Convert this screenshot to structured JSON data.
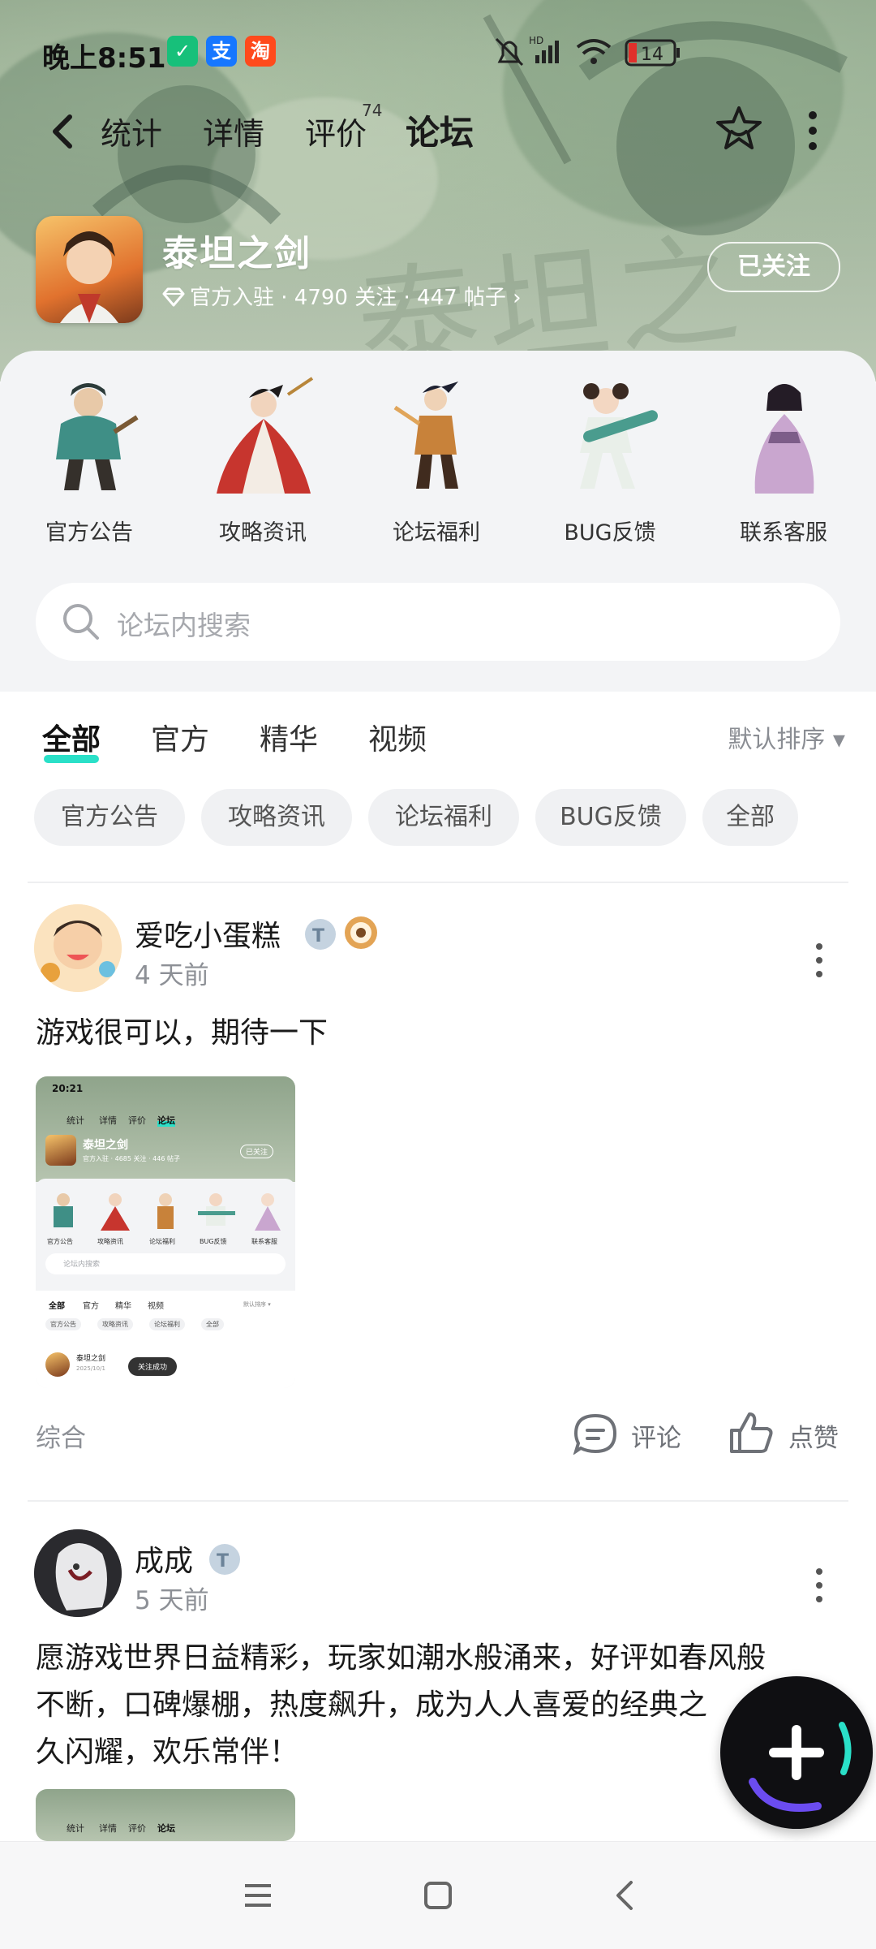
{
  "status_bar": {
    "time": "晚上8:51",
    "battery": "14",
    "network": "HD"
  },
  "nav": {
    "tabs": [
      {
        "label": "统计"
      },
      {
        "label": "详情"
      },
      {
        "label": "评价",
        "count": "74"
      },
      {
        "label": "论坛"
      }
    ],
    "active_tab": "论坛"
  },
  "game": {
    "name": "泰坦之剑",
    "meta": "官方入驻 · 4790 关注 · 447 帖子 ›",
    "follow_label": "已关注"
  },
  "categories": [
    {
      "label": "官方公告",
      "icon": "warrior-character-icon"
    },
    {
      "label": "攻略资讯",
      "icon": "red-dress-character-icon"
    },
    {
      "label": "论坛福利",
      "icon": "swordsman-character-icon"
    },
    {
      "label": "BUG反馈",
      "icon": "gunner-girl-character-icon"
    },
    {
      "label": "联系客服",
      "icon": "purple-dress-character-icon"
    }
  ],
  "search": {
    "placeholder": "论坛内搜索"
  },
  "filter_tabs": [
    {
      "label": "全部"
    },
    {
      "label": "官方"
    },
    {
      "label": "精华"
    },
    {
      "label": "视频"
    }
  ],
  "active_filter": "全部",
  "sort_label": "默认排序 ▾",
  "chips": [
    {
      "label": "官方公告"
    },
    {
      "label": "攻略资讯"
    },
    {
      "label": "论坛福利"
    },
    {
      "label": "BUG反馈"
    },
    {
      "label": "全部"
    }
  ],
  "posts": [
    {
      "user": "爱吃小蛋糕",
      "time": "4 天前",
      "text": "游戏很可以，期待一下",
      "tag": "综合",
      "comment_label": "评论",
      "like_label": "点赞",
      "screenshot": {
        "time": "20:21",
        "tabs": [
          "统计",
          "详情",
          "评价",
          "论坛"
        ],
        "name": "泰坦之剑",
        "meta": "官方入驻 · 4685 关注 · 446 帖子",
        "follow": "已关注",
        "cats": [
          "官方公告",
          "攻略资讯",
          "论坛福利",
          "BUG反馈",
          "联系客服"
        ],
        "search": "论坛内搜索",
        "ftabs": [
          "全部",
          "官方",
          "精华",
          "视频"
        ],
        "sort": "默认排序 ▾",
        "chips": [
          "官方公告",
          "攻略资讯",
          "论坛福利",
          "全部"
        ],
        "post_user": "泰坦之剑",
        "post_date": "2025/10/1",
        "toast": "关注成功"
      }
    },
    {
      "user": "成成",
      "time": "5 天前",
      "text_lines": [
        "愿游戏世界日益精彩，玩家如潮水般涌来，好评如春风般",
        "不断，口碑爆棚，热度飙升，成为人人喜爱的经典之",
        "久闪耀，欢乐常伴！"
      ],
      "screenshot": {
        "tabs": [
          "统计",
          "详情",
          "评价",
          "论坛"
        ]
      }
    }
  ],
  "colors": {
    "accent": "#2ae0c8",
    "fab": "#0f0f12",
    "text_muted": "#8d9096"
  }
}
